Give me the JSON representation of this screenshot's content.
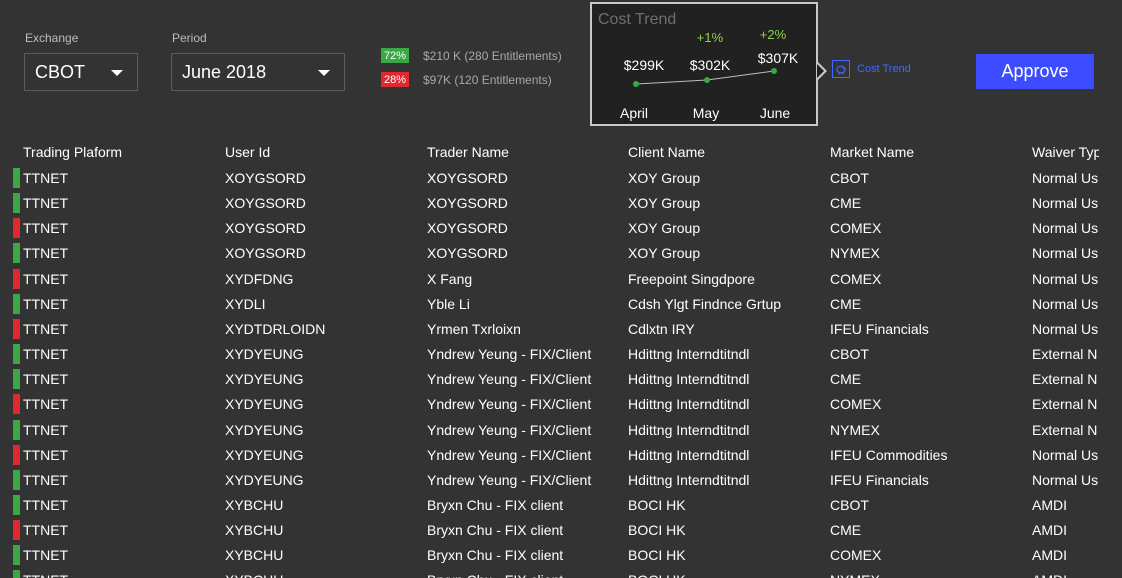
{
  "filters": {
    "exchange_label": "Exchange",
    "exchange_value": "CBOT",
    "period_label": "Period",
    "period_value": "June 2018"
  },
  "entitlements": [
    {
      "pct": "72%",
      "text": "$210 K (280 Entitlements)",
      "color": "#3aa845"
    },
    {
      "pct": "28%",
      "text": "$97K (120 Entitlements)",
      "color": "#e0282f"
    }
  ],
  "cost_trend": {
    "title": "Cost Trend",
    "link_label": "Cost Trend",
    "points": [
      {
        "month": "April",
        "value": "$299K",
        "change": ""
      },
      {
        "month": "May",
        "value": "$302K",
        "change": "+1%"
      },
      {
        "month": "June",
        "value": "$307K",
        "change": "+2%"
      }
    ]
  },
  "approve_label": "Approve",
  "columns": [
    "Trading Plaform",
    "User Id",
    "Trader Name",
    "Client Name",
    "Market Name",
    "Waiver Typ"
  ],
  "status_colors": {
    "green": "#3aa845",
    "red": "#e0282f"
  },
  "rows": [
    {
      "status": "green",
      "cells": [
        "TTNET",
        "XOYGSORD",
        "XOYGSORD",
        "XOY Group",
        "CBOT",
        "Normal Us"
      ]
    },
    {
      "status": "green",
      "cells": [
        "TTNET",
        "XOYGSORD",
        "XOYGSORD",
        "XOY Group",
        "CME",
        "Normal Us"
      ]
    },
    {
      "status": "red",
      "cells": [
        "TTNET",
        "XOYGSORD",
        "XOYGSORD",
        "XOY Group",
        "COMEX",
        "Normal Us"
      ]
    },
    {
      "status": "green",
      "cells": [
        "TTNET",
        "XOYGSORD",
        "XOYGSORD",
        "XOY Group",
        "NYMEX",
        "Normal Us"
      ]
    },
    {
      "status": "red",
      "cells": [
        "TTNET",
        "XYDFDNG",
        "X Fang",
        "Freepoint Singdpore",
        "COMEX",
        "Normal Us"
      ]
    },
    {
      "status": "green",
      "cells": [
        "TTNET",
        "XYDLI",
        "Yble Li",
        "Cdsh Ylgt Findnce Grtup",
        "CME",
        "Normal Us"
      ]
    },
    {
      "status": "red",
      "cells": [
        "TTNET",
        "XYDTDRLOIDN",
        "Yrmen Txrloixn",
        "Cdlxtn IRY",
        "IFEU Financials",
        "Normal Us"
      ]
    },
    {
      "status": "green",
      "cells": [
        "TTNET",
        "XYDYEUNG",
        "Yndrew Yeung - FIX/Client",
        "Hdittng Interndtitndl",
        "CBOT",
        "External N"
      ]
    },
    {
      "status": "green",
      "cells": [
        "TTNET",
        "XYDYEUNG",
        "Yndrew Yeung - FIX/Client",
        "Hdittng Interndtitndl",
        "CME",
        "External N"
      ]
    },
    {
      "status": "red",
      "cells": [
        "TTNET",
        "XYDYEUNG",
        "Yndrew Yeung - FIX/Client",
        "Hdittng Interndtitndl",
        "COMEX",
        "External N"
      ]
    },
    {
      "status": "green",
      "cells": [
        "TTNET",
        "XYDYEUNG",
        "Yndrew Yeung - FIX/Client",
        "Hdittng Interndtitndl",
        "NYMEX",
        "External N"
      ]
    },
    {
      "status": "red",
      "cells": [
        "TTNET",
        "XYDYEUNG",
        "Yndrew Yeung - FIX/Client",
        "Hdittng Interndtitndl",
        "IFEU Commodities",
        "Normal Us"
      ]
    },
    {
      "status": "green",
      "cells": [
        "TTNET",
        "XYDYEUNG",
        "Yndrew Yeung - FIX/Client",
        "Hdittng Interndtitndl",
        "IFEU Financials",
        "Normal Us"
      ]
    },
    {
      "status": "green",
      "cells": [
        "TTNET",
        "XYBCHU",
        "Bryxn Chu - FIX client",
        "BOCI HK",
        "CBOT",
        "AMDI"
      ]
    },
    {
      "status": "red",
      "cells": [
        "TTNET",
        "XYBCHU",
        "Bryxn Chu - FIX client",
        "BOCI HK",
        "CME",
        "AMDI"
      ]
    },
    {
      "status": "green",
      "cells": [
        "TTNET",
        "XYBCHU",
        "Bryxn Chu - FIX client",
        "BOCI HK",
        "COMEX",
        "AMDI"
      ]
    },
    {
      "status": "green",
      "cells": [
        "TTNET",
        "XYBCHU",
        "Bryxn Chu - FIX client",
        "BOCI HK",
        "NYMEX",
        "AMDI"
      ]
    }
  ]
}
